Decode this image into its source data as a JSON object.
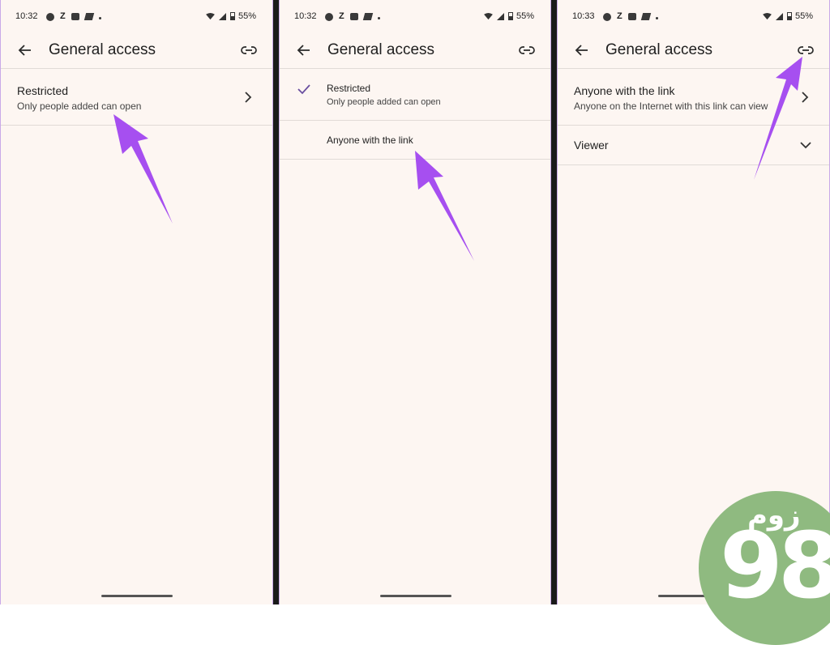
{
  "panels": [
    {
      "status": {
        "time": "10:32",
        "z": "Z",
        "battery": "55%"
      },
      "appbar": {
        "title": "General access"
      },
      "row1": {
        "title": "Restricted",
        "subtitle": "Only people added can open"
      }
    },
    {
      "status": {
        "time": "10:32",
        "z": "Z",
        "battery": "55%"
      },
      "appbar": {
        "title": "General access"
      },
      "options": [
        {
          "title": "Restricted",
          "subtitle": "Only people added can open",
          "checked": true
        },
        {
          "title": "Anyone with the link",
          "checked": false
        }
      ]
    },
    {
      "status": {
        "time": "10:33",
        "z": "Z",
        "battery": "55%"
      },
      "appbar": {
        "title": "General access"
      },
      "row1": {
        "title": "Anyone with the link",
        "subtitle": "Anyone on the Internet with this link can view"
      },
      "row2": {
        "title": "Viewer"
      }
    }
  ],
  "badge": {
    "word": "زوم",
    "number": "98"
  },
  "colors": {
    "arrow": "#a64ff0",
    "accent": "#6a4fa0",
    "background": "#fdf6f2",
    "badge": "#8fba80"
  }
}
